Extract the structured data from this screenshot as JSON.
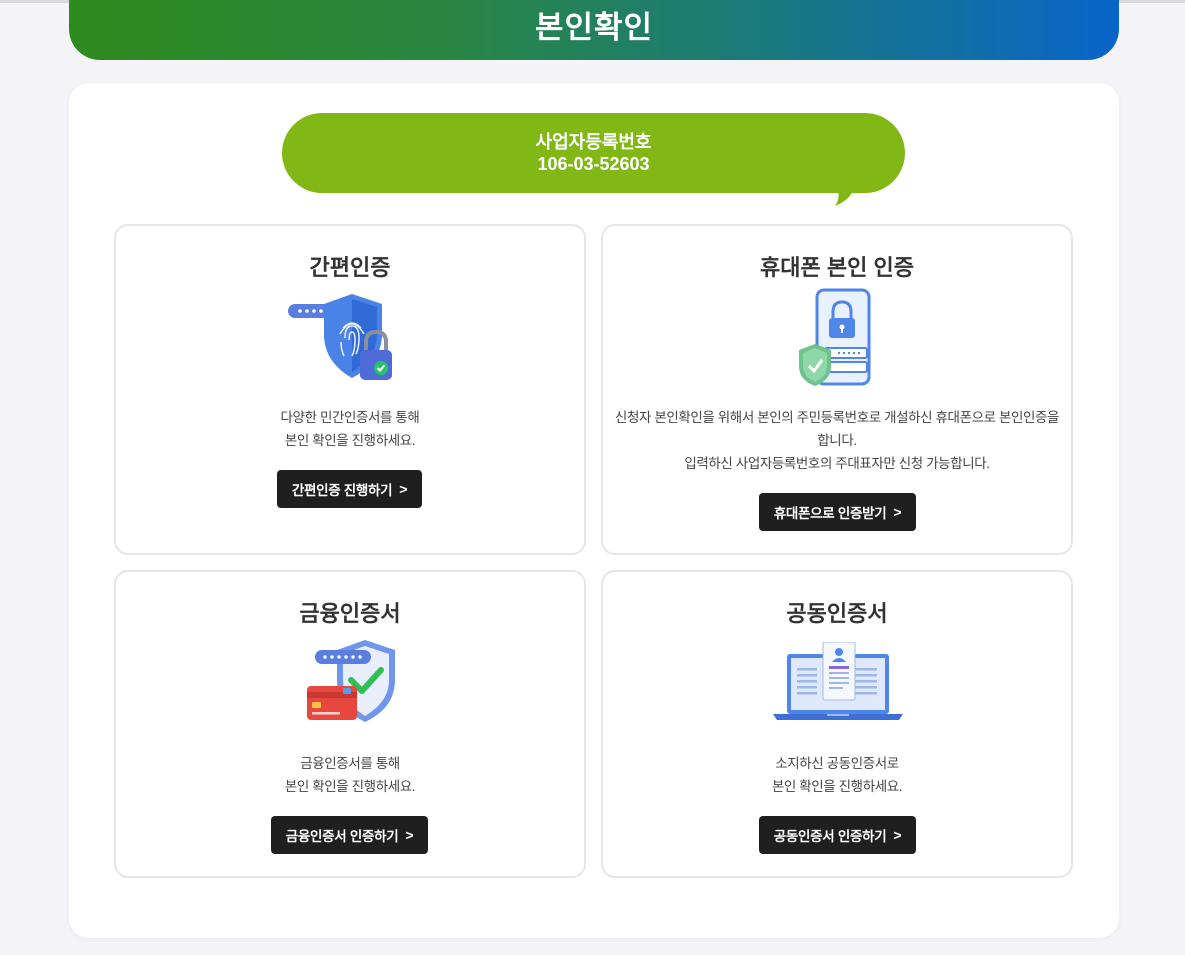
{
  "page": {
    "title": "본인확인"
  },
  "business": {
    "label": "사업자등록번호",
    "number": "106-03-52603"
  },
  "cards": [
    {
      "title": "간편인증",
      "icon": "fingerprint-shield-lock-icon",
      "desc": [
        "다양한 민간인증서를 통해",
        "본인 확인을 진행하세요."
      ],
      "button": "간편인증 진행하기",
      "button_icon": "chevron-right-icon"
    },
    {
      "title": "휴대폰 본인 인증",
      "icon": "phone-lock-shield-icon",
      "desc": [
        "신청자 본인확인을 위해서 본인의 주민등록번호로 개설하신 휴대폰으로 본인인증을",
        "합니다.",
        "입력하신 사업자등록번호의 주대표자만 신청 가능합니다."
      ],
      "button": "휴대폰으로 인증받기",
      "button_icon": "chevron-right-icon"
    },
    {
      "title": "금융인증서",
      "icon": "card-shield-check-icon",
      "desc": [
        "금융인증서를 통해",
        "본인 확인을 진행하세요."
      ],
      "button": "금융인증서 인증하기",
      "button_icon": "chevron-right-icon"
    },
    {
      "title": "공동인증서",
      "icon": "laptop-certificate-icon",
      "desc": [
        "소지하신 공동인증서로",
        "본인 확인을 진행하세요."
      ],
      "button": "공동인증서 인증하기",
      "button_icon": "chevron-right-icon"
    }
  ],
  "colors": {
    "header_gradient_start": "#2e8b1d",
    "header_gradient_end": "#0865c9",
    "bubble": "#82b816",
    "button": "#1f1f1f",
    "background": "#f4f4f8"
  }
}
